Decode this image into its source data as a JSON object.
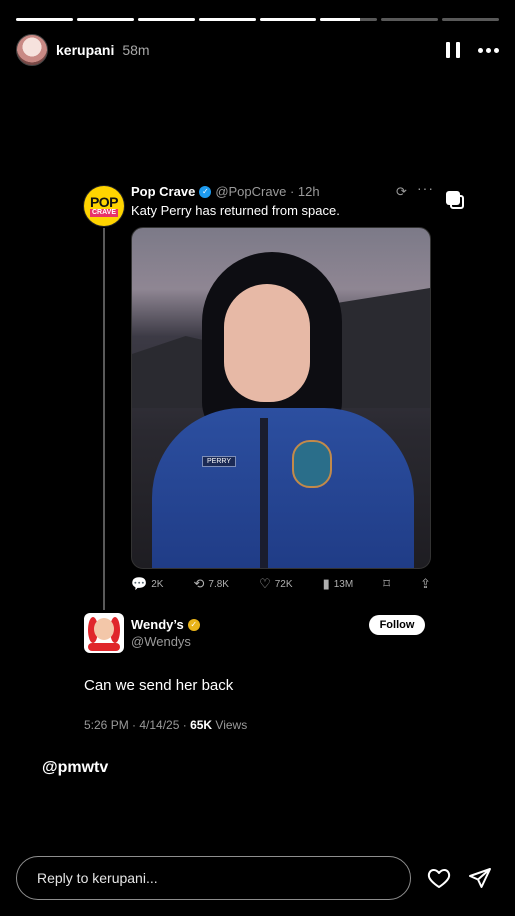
{
  "story": {
    "progress": {
      "segments": 8,
      "completed": 5,
      "current_fraction": 0.7
    },
    "user": {
      "username": "kerupani",
      "time_ago": "58m"
    },
    "mention": "@pmwtv"
  },
  "tweet": {
    "author_name": "Pop Crave",
    "author_handle": "@PopCrave",
    "time": "12h",
    "logo_top": "POP",
    "logo_bottom": "CRAVE",
    "text": "Katy Perry has returned from space.",
    "photo_nametag": "PERRY",
    "stats": {
      "replies": "2K",
      "reposts": "7.8K",
      "likes": "72K",
      "views": "13M"
    }
  },
  "reply_tweet": {
    "author_name": "Wendy’s",
    "author_handle": "@Wendys",
    "follow_label": "Follow",
    "text": "Can we send her back",
    "timestamp": "5:26 PM · 4/14/25 · ",
    "views_count": "65K",
    "views_label": " Views"
  },
  "footer": {
    "reply_placeholder": "Reply to kerupani..."
  },
  "colors": {
    "verified_blue": "#1d9bf0",
    "verified_gold": "#e9b319",
    "background": "#000000"
  }
}
